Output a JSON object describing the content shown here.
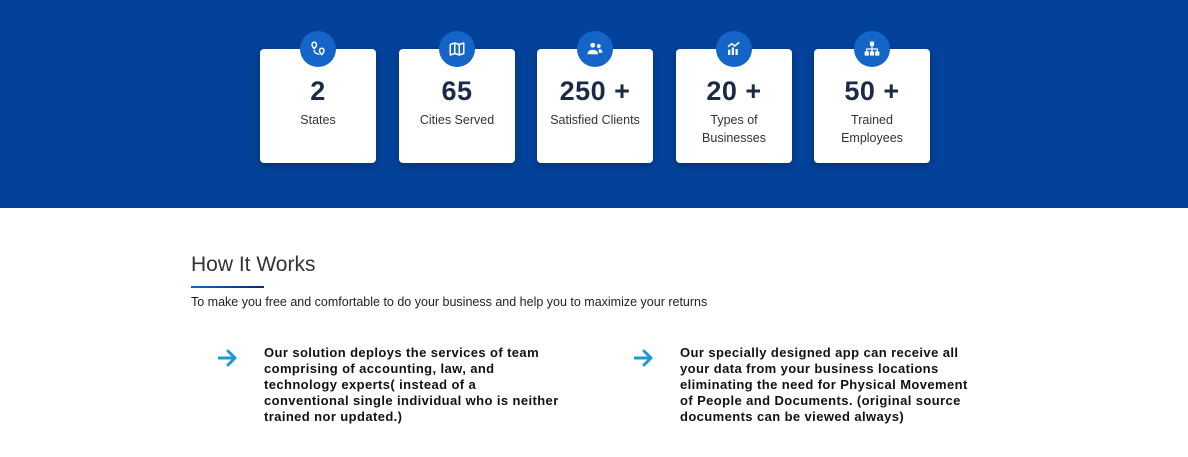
{
  "stats": [
    {
      "icon": "map-pins-icon",
      "value": "2",
      "label": "States"
    },
    {
      "icon": "map-icon",
      "value": "65",
      "label": "Cities Served"
    },
    {
      "icon": "users-icon",
      "value": "250 +",
      "label": "Satisfied Clients"
    },
    {
      "icon": "business-chart-icon",
      "value": "20 +",
      "label": "Types of Businesses"
    },
    {
      "icon": "org-chart-icon",
      "value": "50 +",
      "label": "Trained Employees"
    }
  ],
  "how_it_works": {
    "title": "How It Works",
    "subtitle": "To make you free and comfortable to do your business and help you to maximize your returns",
    "features": [
      {
        "icon": "arrow-right-icon",
        "text": "Our solution deploys the services of team comprising of accounting, law, and technology experts( instead of a conventional single individual who is neither trained nor updated.)"
      },
      {
        "icon": "arrow-right-icon",
        "text": "Our specially designed app can receive all your data from your business locations eliminating the need for Physical Movement of People and Documents. (original source documents can be viewed always)"
      }
    ]
  },
  "colors": {
    "band_background": "#03429a",
    "icon_circle": "#1565c8",
    "arrow": "#1a9ad6"
  }
}
